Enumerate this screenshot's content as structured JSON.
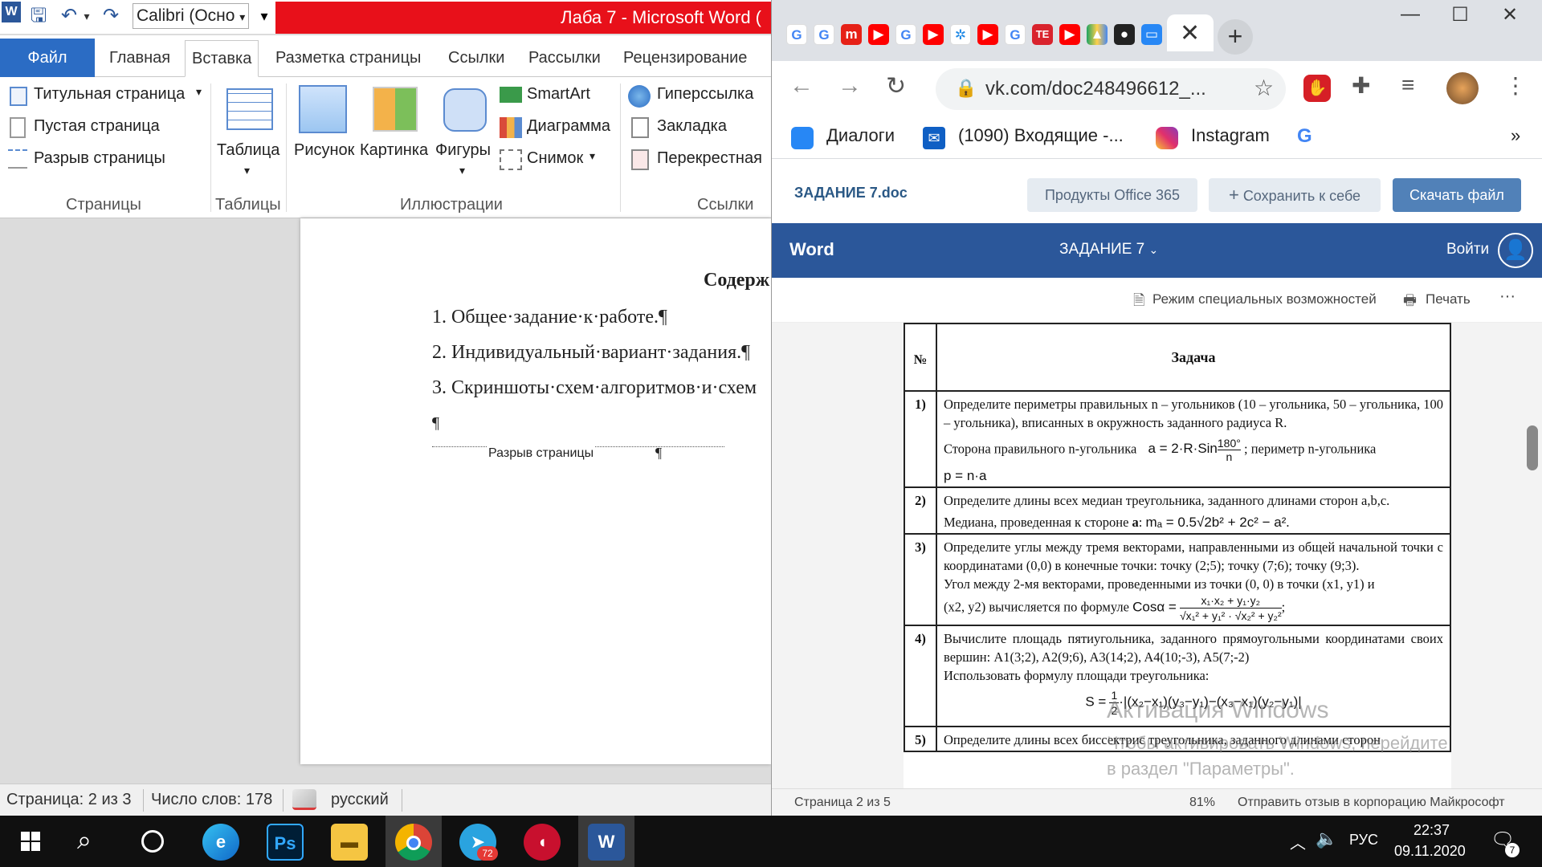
{
  "word": {
    "font_name": "Calibri (Осно",
    "title": "Лаба 7  -  Microsoft Word (",
    "tabs": [
      "Файл",
      "Главная",
      "Вставка",
      "Разметка страницы",
      "Ссылки",
      "Рассылки",
      "Рецензирование"
    ],
    "ribbon": {
      "pages": {
        "items": [
          "Титульная страница",
          "Пустая страница",
          "Разрыв страницы"
        ],
        "group": "Страницы"
      },
      "tables": {
        "label": "Таблица",
        "group": "Таблицы"
      },
      "illustrations": {
        "picture": "Рисунок",
        "clipart": "Картинка",
        "shapes": "Фигуры",
        "smartart": "SmartArt",
        "chart": "Диаграмма",
        "screenshot": "Снимок",
        "group": "Иллюстрации"
      },
      "links": {
        "items": [
          "Гиперссылка",
          "Закладка",
          "Перекрестная"
        ],
        "group": "Ссылки"
      }
    },
    "document": {
      "heading": "Содерж",
      "items": [
        "1. Общее·задание·к·работе.¶",
        "2. Индивидуальный·вариант·задания.¶",
        "3. Скриншоты·схем·алгоритмов·и·схем"
      ],
      "pilcrow": "¶",
      "page_break": "Разрыв страницы",
      "page_break_mark": "¶"
    },
    "status": {
      "page": "Страница: 2 из 3",
      "words": "Число слов: 178",
      "lang": "русский"
    }
  },
  "browser": {
    "url": "vk.com/doc248496612_...",
    "bookmarks": [
      "Диалоги",
      "(1090) Входящие -...",
      "Instagram"
    ],
    "more": "»",
    "vk": {
      "doc_name": "ЗАДАНИЕ 7.doc",
      "office_btn": "Продукты Office 365",
      "save_btn": "Сохранить к себе",
      "download_btn": "Скачать файл"
    },
    "office": {
      "app": "Word",
      "doc_title": "ЗАДАНИЕ 7",
      "signin": "Войти",
      "accessibility": "Режим специальных возможностей",
      "print": "Печать",
      "more": "···"
    },
    "table": {
      "header_num": "№",
      "header_task": "Задача",
      "rows": [
        {
          "num": "1)",
          "text": "Определите периметры правильных n – угольников (10 – угольника, 50 – угольника, 100 – угольника), вписанных в окружность заданного радиуса R.",
          "text2": "Сторона правильного n-угольника",
          "formula": "a = 2·R·Sin",
          "frac_top": "180°",
          "frac_bot": "n",
          "text3": "; периметр n-угольника",
          "formula2": "p = n·a"
        },
        {
          "num": "2)",
          "text": "Определите длины всех медиан треугольника, заданного длинами сторон a,b,c.",
          "text2": "Медиана, проведенная к стороне",
          "bold": "a",
          "formula": "mₐ = 0.5√2b² + 2c² − a²"
        },
        {
          "num": "3)",
          "text": "Определите углы между тремя векторами, направленными из общей начальной точки с координатами (0,0) в конечные точки: точку (2;5); точку (7;6); точку (9;3).",
          "text2": "Угол между 2-мя векторами, проведенными из точки (0, 0) в точки (x1, y1) и",
          "text3": "(x2, y2) вычисляется по формуле",
          "formula": "Cosα =",
          "frac_top": "x₁·x₂ + y₁·y₂",
          "frac_bot": "√x₁² + y₁² · √x₂² + y₂²"
        },
        {
          "num": "4)",
          "text": "Вычислите площадь пятиугольника, заданного прямоугольными координатами своих вершин: A1(3;2), A2(9;6), A3(14;2), A4(10;-3), A5(7;-2)",
          "text2": "Использовать формулу площади треугольника:",
          "formula": "S =",
          "frac_top": "1",
          "frac_bot": "2",
          "formula_b": "·|(x₂−x₁)(y₃−y₁)−(x₃−x₁)(y₂−y₁)|"
        },
        {
          "num": "5)",
          "text": "Определите длины всех биссектрис треугольника, заданного длинами сторон"
        }
      ]
    },
    "footer": {
      "page": "Страница 2 из 5",
      "zoom": "81%",
      "feedback": "Отправить отзыв в корпорацию Майкрософт"
    },
    "watermark": {
      "line1": "Активация Windows",
      "line2": "Чтобы активировать Windows, перейдите",
      "line3": "в раздел \"Параметры\"."
    }
  },
  "taskbar": {
    "lang": "РУС",
    "time": "22:37",
    "date": "09.11.2020",
    "telegram_badge": "72",
    "notif_badge": "7"
  }
}
